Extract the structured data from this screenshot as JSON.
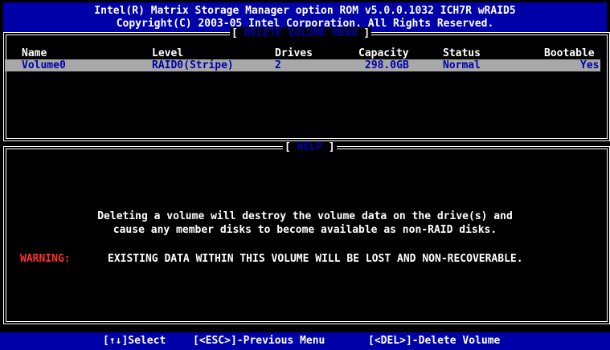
{
  "header": {
    "line1": "Intel(R) Matrix Storage Manager option ROM v5.0.0.1032 ICH7R wRAID5",
    "line2": "Copyright(C) 2003-05 Intel Corporation.  All Rights Reserved."
  },
  "volume_menu": {
    "title": "DELETE VOLUME MENU",
    "columns": [
      "Name",
      "Level",
      "Drives",
      "Capacity",
      "Status",
      "Bootable"
    ],
    "rows": [
      {
        "name": "Volume0",
        "level": "RAID0(Stripe)",
        "drives": "2",
        "capacity": "298.0GB",
        "status": "Normal",
        "bootable": "Yes"
      }
    ]
  },
  "help": {
    "title": "HELP",
    "line1": "Deleting a volume will destroy the volume data on the drive(s) and",
    "line2": "cause any member disks to become available as non-RAID disks.",
    "warning_label": "WARNING:",
    "warning_text": "EXISTING DATA WITHIN THIS VOLUME WILL BE LOST AND NON-RECOVERABLE."
  },
  "footer": {
    "select": "[↑↓]Select",
    "esc": "[<ESC>]-Previous Menu",
    "del": "[<DEL>]-Delete Volume"
  },
  "colors": {
    "background": "#000000",
    "blue": "#0000a8",
    "gray": "#a8a8a8",
    "white": "#ffffff",
    "warning": "#ff3030"
  }
}
